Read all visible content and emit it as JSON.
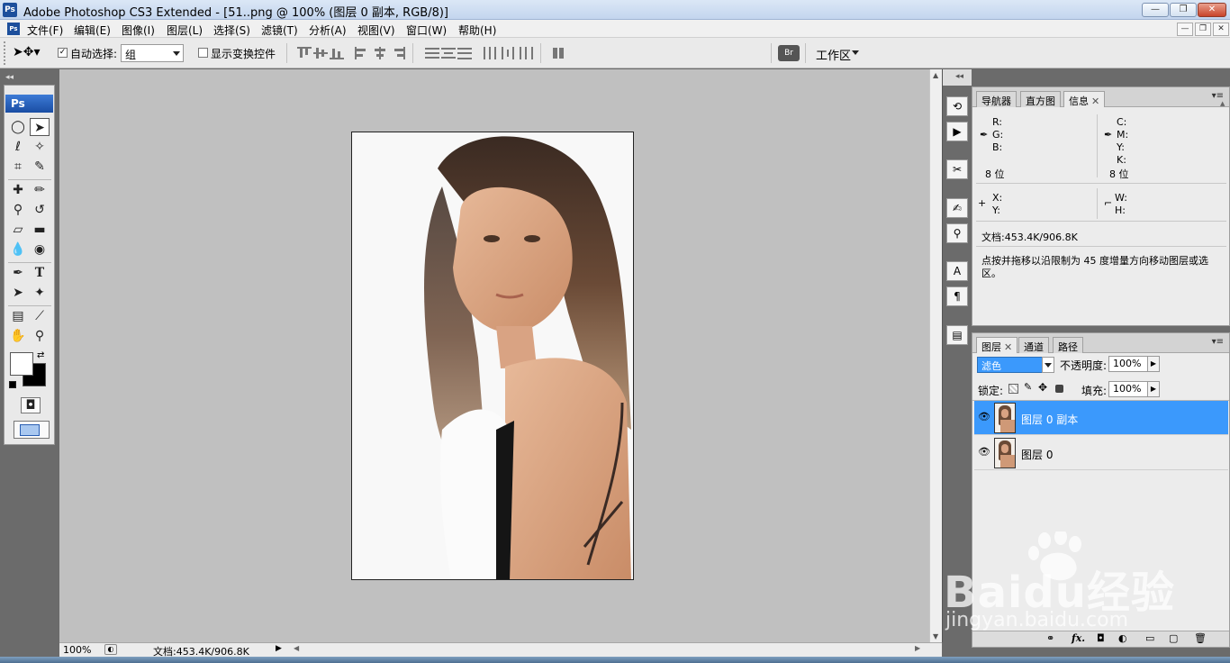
{
  "window": {
    "title": "Adobe Photoshop CS3 Extended - [51..png @ 100% (图层 0 副本, RGB/8)]",
    "app_icon": "Ps"
  },
  "menu": [
    "文件(F)",
    "编辑(E)",
    "图像(I)",
    "图层(L)",
    "选择(S)",
    "滤镜(T)",
    "分析(A)",
    "视图(V)",
    "窗口(W)",
    "帮助(H)"
  ],
  "options": {
    "auto_select_label": "自动选择:",
    "auto_select_checked": true,
    "auto_select_value": "组",
    "show_transform_label": "显示变换控件",
    "show_transform_checked": false,
    "workspace_label": "工作区"
  },
  "toolbox": {
    "header": "Ps",
    "foreground_color": "#ffffff",
    "background_color": "#000000"
  },
  "status": {
    "zoom": "100%",
    "doc_size": "文档:453.4K/906.8K"
  },
  "info_panel": {
    "tabs": [
      "导航器",
      "直方图",
      "信息"
    ],
    "active_tab": "信息",
    "rgb_labels": [
      "R:",
      "G:",
      "B:"
    ],
    "cmyk_labels": [
      "C:",
      "M:",
      "Y:",
      "K:"
    ],
    "bits_left": "8 位",
    "bits_right": "8 位",
    "xy_labels": [
      "X:",
      "Y:"
    ],
    "wh_labels": [
      "W:",
      "H:"
    ],
    "doc_size": "文档:453.4K/906.8K",
    "hint": "点按并拖移以沿限制为 45 度增量方向移动图层或选区。"
  },
  "layers_panel": {
    "tabs": [
      "图层",
      "通道",
      "路径"
    ],
    "active_tab": "图层",
    "blend_mode": "滤色",
    "opacity_label": "不透明度:",
    "opacity": "100%",
    "lock_label": "锁定:",
    "fill_label": "填充:",
    "fill": "100%",
    "layers": [
      {
        "name": "图层 0 副本",
        "selected": true
      },
      {
        "name": "图层 0",
        "selected": false
      }
    ],
    "footer_fx": "fx."
  },
  "watermark": {
    "brand": "Baidu经验",
    "url": "jingyan.baidu.com"
  },
  "colors": {
    "selection_blue": "#3b99fc",
    "workspace_gray": "#c0c0c0",
    "panel_bg": "#ececec"
  }
}
